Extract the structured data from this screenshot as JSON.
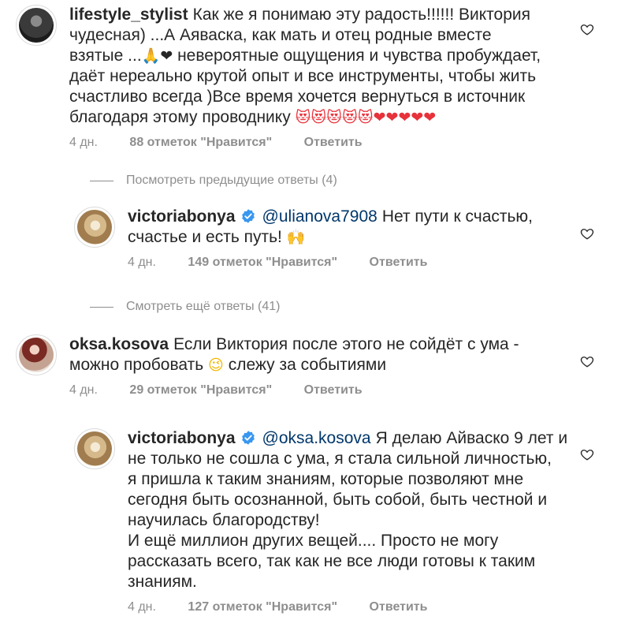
{
  "comments": [
    {
      "username": "lifestyle_stylist",
      "text_line1": "Как же я понимаю эту радость!!!!!! Виктория",
      "text_line2": "чудесная) ...А Аяваска, как мать и отец родные вместе",
      "text_line3a": "взятые ...",
      "emoji_line3": "🙏❤",
      "text_line3b": "невероятные ощущения и чувства пробуждает,",
      "text_line4": "даёт нереально крутой опыт и все инструменты, чтобы жить",
      "text_line5": "счастливо всегда )Все время хочется вернуться в источник",
      "text_line6": "благодаря этому проводнику",
      "emoji_line6": "😻😻😻😻😻❤❤❤❤❤",
      "time": "4 дн.",
      "likes": "88 отметок \"Нравится\"",
      "reply": "Ответить",
      "avatar_icon": "avatar-dark-silhouette"
    },
    {
      "username": "victoriabonya",
      "mention": "@ulianova7908",
      "text_line1": "Нет пути к счастью,",
      "text_line2": "счастье и есть путь!",
      "emoji_line2": "🙌",
      "time": "4 дн.",
      "likes": "149 отметок \"Нравится\"",
      "reply": "Ответить",
      "avatar_icon": "avatar-gold-dress"
    },
    {
      "username": "oksa.kosova",
      "text_line1": "Если Виктория после этого не сойдёт с ума -",
      "text_line2a": "можно пробовать",
      "emoji_line2": "😉",
      "text_line2b": "слежу за событиями",
      "time": "4 дн.",
      "likes": "29 отметок \"Нравится\"",
      "reply": "Ответить",
      "avatar_icon": "avatar-red-hair"
    },
    {
      "username": "victoriabonya",
      "mention": "@oksa.kosova",
      "text_line1": "Я делаю Айваско 9 лет и",
      "text_line2": "не только не сошла с ума, я стала сильной личностью,",
      "text_line3": "я пришла к таким знаниям, которые позволяют мне",
      "text_line4": "сегодня быть осознанной, быть собой, быть честной и",
      "text_line5": "научилась благородству!",
      "text_line6": "И ещё миллион других вещей.... Просто не могу",
      "text_line7": "рассказать всего, так как не все люди готовы к таким",
      "text_line8": "знаниям.",
      "time": "4 дн.",
      "likes": "127 отметок \"Нравится\"",
      "reply": "Ответить",
      "avatar_icon": "avatar-gold-dress"
    }
  ],
  "view_previous_replies": "Посмотреть предыдущие ответы (4)",
  "view_more_replies": "Смотреть ещё ответы (41)",
  "colors": {
    "text": "#262626",
    "secondary": "#8e8e8e",
    "mention": "#00376b",
    "verified": "#3897f0"
  }
}
